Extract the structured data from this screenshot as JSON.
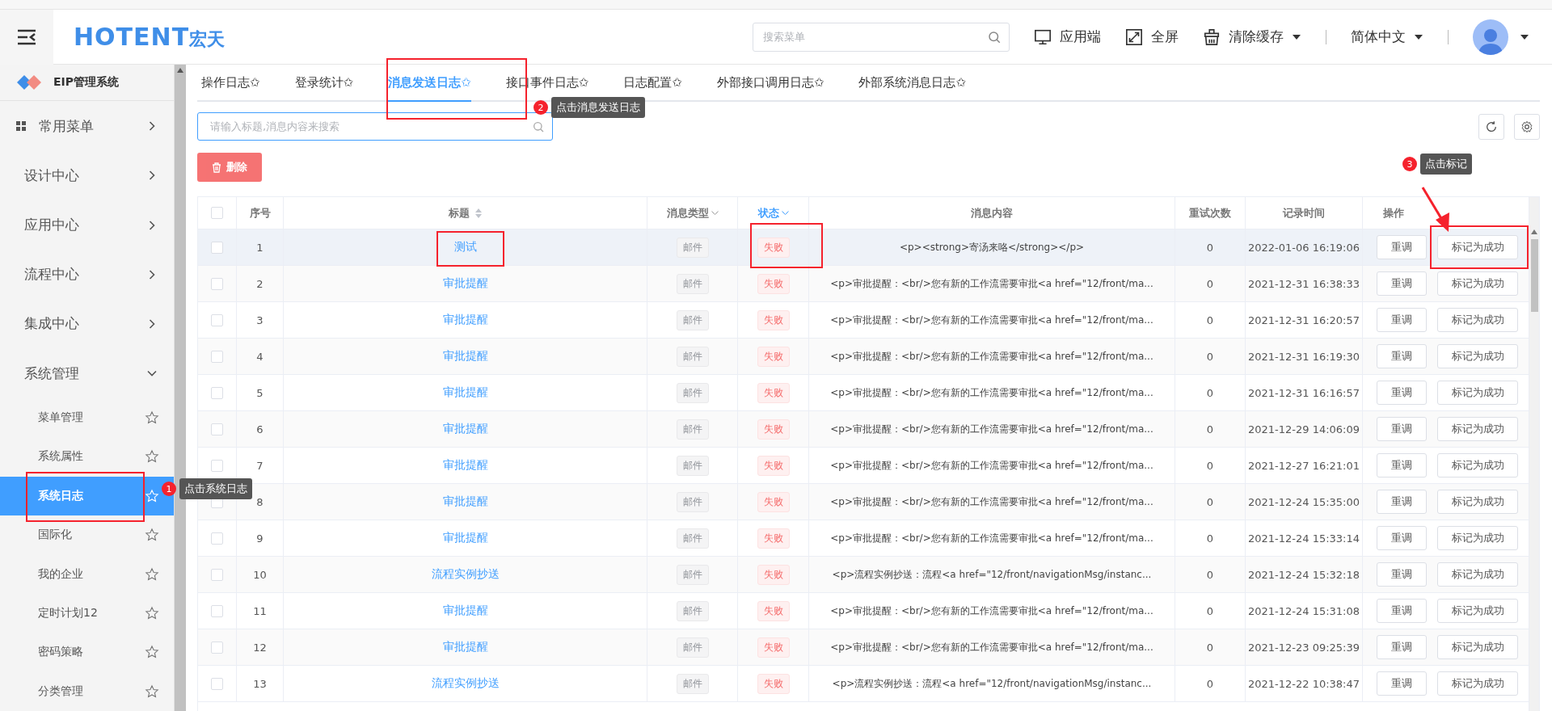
{
  "header": {
    "logo": "HOTENT",
    "logo_cn": "宏天",
    "search": {
      "placeholder": "搜索菜单"
    },
    "actions": [
      {
        "label": "应用端",
        "kind": "monitor"
      },
      {
        "label": "全屏",
        "kind": "fullscreen"
      },
      {
        "label": "清除缓存",
        "kind": "broom"
      }
    ],
    "language": "简体中文"
  },
  "sidebar": {
    "system": "EIP管理系统",
    "items": [
      {
        "label": "常用菜单",
        "kind": "favorites",
        "expanded": false
      },
      {
        "label": "设计中心",
        "kind": "menu",
        "expanded": false
      },
      {
        "label": "应用中心",
        "kind": "menu",
        "expanded": false
      },
      {
        "label": "流程中心",
        "kind": "menu",
        "expanded": false
      },
      {
        "label": "集成中心",
        "kind": "menu",
        "expanded": false
      },
      {
        "label": "系统管理",
        "kind": "menu",
        "expanded": true,
        "children": [
          {
            "label": "菜单管理",
            "selected": false
          },
          {
            "label": "系统属性",
            "selected": false
          },
          {
            "label": "系统日志",
            "selected": true
          },
          {
            "label": "国际化",
            "selected": false
          },
          {
            "label": "我的企业",
            "selected": false
          },
          {
            "label": "定时计划12",
            "selected": false
          },
          {
            "label": "密码策略",
            "selected": false
          },
          {
            "label": "分类管理",
            "selected": false
          }
        ]
      }
    ]
  },
  "tabs": [
    {
      "label": "操作日志✩",
      "selected": false
    },
    {
      "label": "登录统计✩",
      "selected": false
    },
    {
      "label": "消息发送日志✩",
      "selected": true
    },
    {
      "label": "接口事件日志✩",
      "selected": false
    },
    {
      "label": "日志配置✩",
      "selected": false
    },
    {
      "label": "外部接口调用日志✩",
      "selected": false
    },
    {
      "label": "外部系统消息日志✩",
      "selected": false
    }
  ],
  "search": {
    "placeholder": "请输入标题,消息内容来搜索"
  },
  "delete_button": "删除",
  "table": {
    "select_all_checked": false,
    "columns": [
      {
        "label": "序号",
        "kind": "plain"
      },
      {
        "label": "标题",
        "kind": "sort"
      },
      {
        "label": "消息类型",
        "kind": "filter",
        "filtered": false
      },
      {
        "label": "状态",
        "kind": "filter",
        "filtered": true
      },
      {
        "label": "消息内容",
        "kind": "plain"
      },
      {
        "label": "重试次数",
        "kind": "plain"
      },
      {
        "label": "记录时间",
        "kind": "plain"
      },
      {
        "label": "操作",
        "kind": "plain"
      }
    ],
    "rows": [
      {
        "index": "1",
        "title": "测试",
        "type": "邮件",
        "status": "失败",
        "content": "<p><strong>寄汤来咯</strong></p>",
        "retries": "0",
        "time": "2022-01-06 16:19:06",
        "highlighted": true,
        "retry_button": "重调",
        "mark_button": "标记为成功"
      },
      {
        "index": "2",
        "title": "审批提醒",
        "type": "邮件",
        "status": "失败",
        "content": "<p>审批提醒：<br/>您有新的工作流需要审批<a href=\"12/front/ma...",
        "retries": "0",
        "time": "2021-12-31 16:38:33",
        "highlighted": false,
        "retry_button": "重调",
        "mark_button": "标记为成功"
      },
      {
        "index": "3",
        "title": "审批提醒",
        "type": "邮件",
        "status": "失败",
        "content": "<p>审批提醒：<br/>您有新的工作流需要审批<a href=\"12/front/ma...",
        "retries": "0",
        "time": "2021-12-31 16:20:57",
        "highlighted": false,
        "retry_button": "重调",
        "mark_button": "标记为成功"
      },
      {
        "index": "4",
        "title": "审批提醒",
        "type": "邮件",
        "status": "失败",
        "content": "<p>审批提醒：<br/>您有新的工作流需要审批<a href=\"12/front/ma...",
        "retries": "0",
        "time": "2021-12-31 16:19:30",
        "highlighted": false,
        "retry_button": "重调",
        "mark_button": "标记为成功"
      },
      {
        "index": "5",
        "title": "审批提醒",
        "type": "邮件",
        "status": "失败",
        "content": "<p>审批提醒：<br/>您有新的工作流需要审批<a href=\"12/front/ma...",
        "retries": "0",
        "time": "2021-12-31 16:16:57",
        "highlighted": false,
        "retry_button": "重调",
        "mark_button": "标记为成功"
      },
      {
        "index": "6",
        "title": "审批提醒",
        "type": "邮件",
        "status": "失败",
        "content": "<p>审批提醒：<br/>您有新的工作流需要审批<a href=\"12/front/ma...",
        "retries": "0",
        "time": "2021-12-29 14:06:09",
        "highlighted": false,
        "retry_button": "重调",
        "mark_button": "标记为成功"
      },
      {
        "index": "7",
        "title": "审批提醒",
        "type": "邮件",
        "status": "失败",
        "content": "<p>审批提醒：<br/>您有新的工作流需要审批<a href=\"12/front/ma...",
        "retries": "0",
        "time": "2021-12-27 16:21:01",
        "highlighted": false,
        "retry_button": "重调",
        "mark_button": "标记为成功"
      },
      {
        "index": "8",
        "title": "审批提醒",
        "type": "邮件",
        "status": "失败",
        "content": "<p>审批提醒：<br/>您有新的工作流需要审批<a href=\"12/front/ma...",
        "retries": "0",
        "time": "2021-12-24 15:35:00",
        "highlighted": false,
        "retry_button": "重调",
        "mark_button": "标记为成功"
      },
      {
        "index": "9",
        "title": "审批提醒",
        "type": "邮件",
        "status": "失败",
        "content": "<p>审批提醒：<br/>您有新的工作流需要审批<a href=\"12/front/ma...",
        "retries": "0",
        "time": "2021-12-24 15:33:14",
        "highlighted": false,
        "retry_button": "重调",
        "mark_button": "标记为成功"
      },
      {
        "index": "10",
        "title": "流程实例抄送",
        "type": "邮件",
        "status": "失败",
        "content": "<p>流程实例抄送：流程<a href=\"12/front/navigationMsg/instanc...",
        "retries": "0",
        "time": "2021-12-24 15:32:18",
        "highlighted": false,
        "retry_button": "重调",
        "mark_button": "标记为成功"
      },
      {
        "index": "11",
        "title": "审批提醒",
        "type": "邮件",
        "status": "失败",
        "content": "<p>审批提醒：<br/>您有新的工作流需要审批<a href=\"12/front/ma...",
        "retries": "0",
        "time": "2021-12-24 15:31:08",
        "highlighted": false,
        "retry_button": "重调",
        "mark_button": "标记为成功"
      },
      {
        "index": "12",
        "title": "审批提醒",
        "type": "邮件",
        "status": "失败",
        "content": "<p>审批提醒：<br/>您有新的工作流需要审批<a href=\"12/front/ma...",
        "retries": "0",
        "time": "2021-12-23 09:25:39",
        "highlighted": false,
        "retry_button": "重调",
        "mark_button": "标记为成功"
      },
      {
        "index": "13",
        "title": "流程实例抄送",
        "type": "邮件",
        "status": "失败",
        "content": "<p>流程实例抄送：流程<a href=\"12/front/navigationMsg/instanc...",
        "retries": "0",
        "time": "2021-12-22 10:38:47",
        "highlighted": false,
        "retry_button": "重调",
        "mark_button": "标记为成功"
      }
    ]
  },
  "annotations": [
    {
      "number": "1",
      "text": "点击系统日志"
    },
    {
      "number": "2",
      "text": "点击消息发送日志"
    },
    {
      "number": "3",
      "text": "点击标记"
    }
  ]
}
